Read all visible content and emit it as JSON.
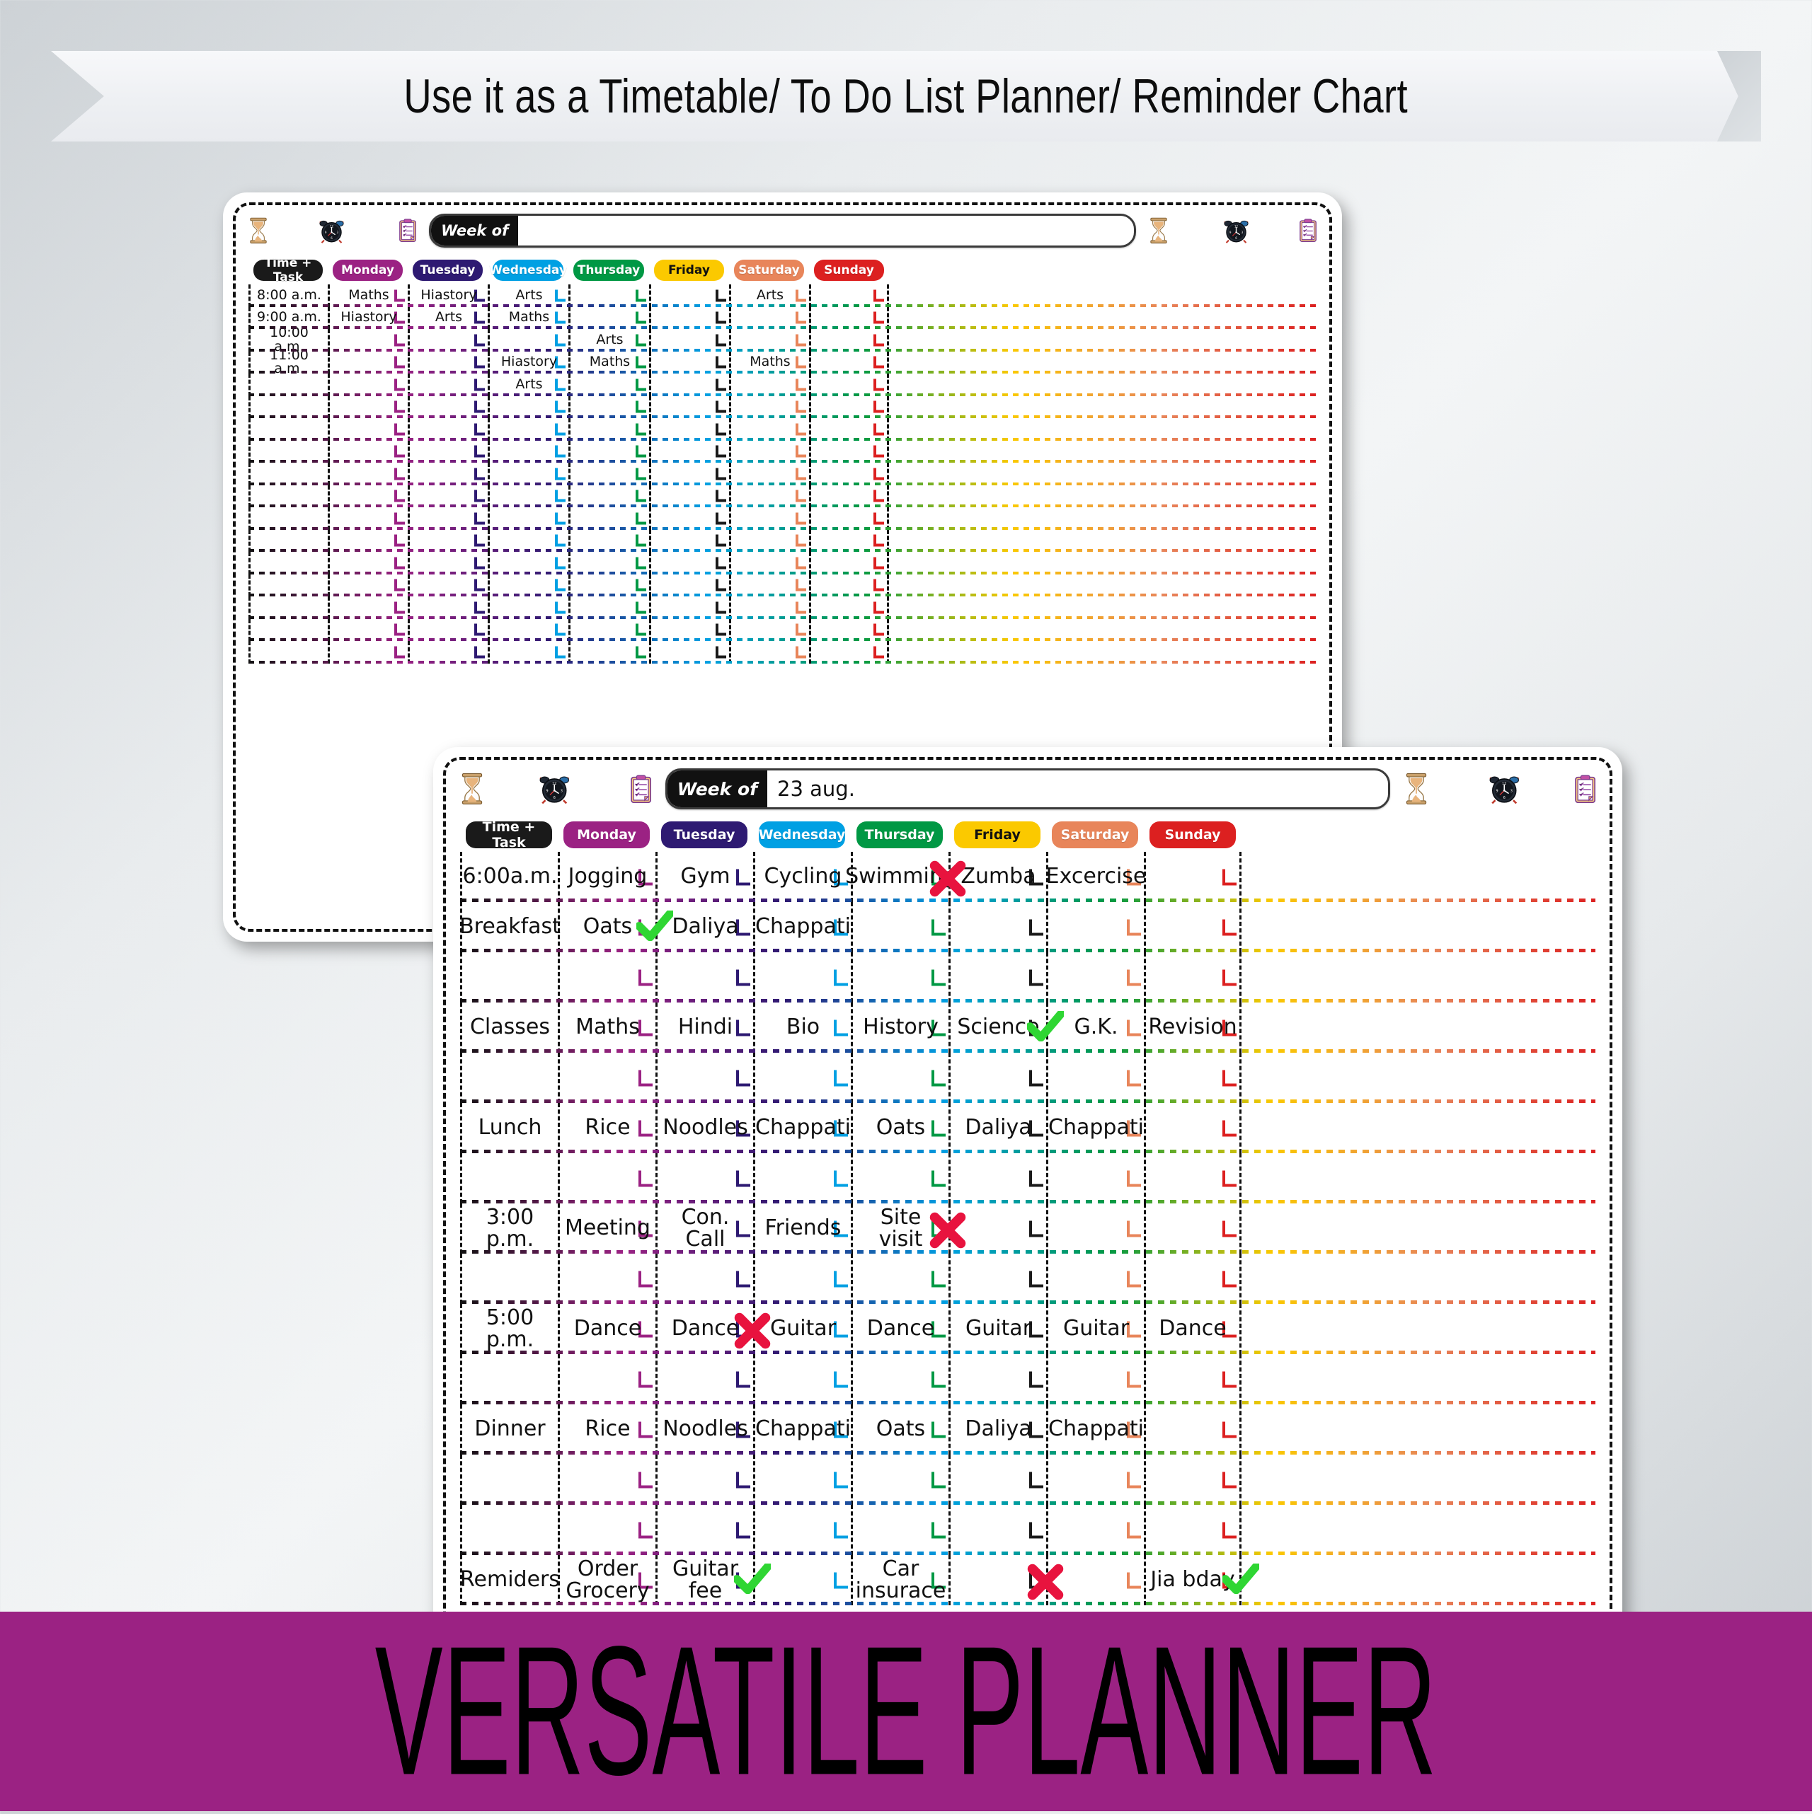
{
  "top_banner": {
    "text": "Use it as a Timetable/ To Do List Planner/ Reminder Chart"
  },
  "bottom_banner": {
    "text": "VERSATILE PLANNER",
    "background": "#9B2283",
    "text_color": "#000000"
  },
  "colors": {
    "time_task": "#1a1a1a",
    "monday": "#9B2283",
    "tuesday": "#2E1A72",
    "wednesday": "#00A0E3",
    "thursday": "#009844",
    "friday": "#FBC900",
    "saturday": "#E8855A",
    "sunday": "#DC2020",
    "friday_bracket": "#1a1a1a",
    "check_green": "#2FD633",
    "cross_red": "#E8133E"
  },
  "header_icons": [
    "hourglass-icon",
    "alarm-clock-icon",
    "clipboard-checklist-icon"
  ],
  "columns": {
    "time_task_label": "Time + Task",
    "days": [
      "Monday",
      "Tuesday",
      "Wednesday",
      "Thursday",
      "Friday",
      "Saturday",
      "Sunday"
    ]
  },
  "week_of": {
    "label": "Week of"
  },
  "planner_back": {
    "week_of_value": "",
    "rows": [
      {
        "time": "8:00 a.m.",
        "cells": [
          "Maths",
          "Hiastory",
          "Arts",
          "",
          "",
          "Arts",
          ""
        ]
      },
      {
        "time": "9:00 a.m.",
        "cells": [
          "Hiastory",
          "Arts",
          "Maths",
          "",
          "",
          "",
          ""
        ]
      },
      {
        "time": "10:00 a.m.",
        "cells": [
          "",
          "",
          "",
          "Arts",
          "",
          "",
          ""
        ]
      },
      {
        "time": "11:00 a.m.",
        "cells": [
          "",
          "",
          "Hiastory",
          "Maths",
          "",
          "Maths",
          ""
        ]
      },
      {
        "time": "",
        "cells": [
          "",
          "",
          "Arts",
          "",
          "",
          "",
          ""
        ]
      },
      {
        "time": "",
        "cells": [
          "",
          "",
          "",
          "",
          "",
          "",
          ""
        ]
      },
      {
        "time": "",
        "cells": [
          "",
          "",
          "",
          "",
          "",
          "",
          ""
        ]
      },
      {
        "time": "",
        "cells": [
          "",
          "",
          "",
          "",
          "",
          "",
          ""
        ]
      },
      {
        "time": "",
        "cells": [
          "",
          "",
          "",
          "",
          "",
          "",
          ""
        ]
      },
      {
        "time": "",
        "cells": [
          "",
          "",
          "",
          "",
          "",
          "",
          ""
        ]
      },
      {
        "time": "",
        "cells": [
          "",
          "",
          "",
          "",
          "",
          "",
          ""
        ]
      },
      {
        "time": "",
        "cells": [
          "",
          "",
          "",
          "",
          "",
          "",
          ""
        ]
      },
      {
        "time": "",
        "cells": [
          "",
          "",
          "",
          "",
          "",
          "",
          ""
        ]
      },
      {
        "time": "",
        "cells": [
          "",
          "",
          "",
          "",
          "",
          "",
          ""
        ]
      },
      {
        "time": "",
        "cells": [
          "",
          "",
          "",
          "",
          "",
          "",
          ""
        ]
      },
      {
        "time": "",
        "cells": [
          "",
          "",
          "",
          "",
          "",
          "",
          ""
        ]
      },
      {
        "time": "",
        "cells": [
          "",
          "",
          "",
          "",
          "",
          "",
          ""
        ]
      }
    ]
  },
  "planner_front": {
    "week_of_value": "23 aug.",
    "rows": [
      {
        "time": "6:00a.m.",
        "cells": [
          "Jogging",
          "Gym",
          "Cycling",
          "Swimming",
          "Zumba",
          "Excercise",
          ""
        ]
      },
      {
        "time": "Breakfast",
        "cells": [
          "Oats",
          "Daliya",
          "Chappati",
          "",
          "",
          "",
          ""
        ]
      },
      {
        "time": "",
        "cells": [
          "",
          "",
          "",
          "",
          "",
          "",
          ""
        ]
      },
      {
        "time": "Classes",
        "cells": [
          "Maths",
          "Hindi",
          "Bio",
          "History",
          "Science",
          "G.K.",
          "Revision"
        ]
      },
      {
        "time": "",
        "cells": [
          "",
          "",
          "",
          "",
          "",
          "",
          ""
        ]
      },
      {
        "time": "Lunch",
        "cells": [
          "Rice",
          "Noodles",
          "Chappati",
          "Oats",
          "Daliya",
          "Chappati",
          ""
        ]
      },
      {
        "time": "",
        "cells": [
          "",
          "",
          "",
          "",
          "",
          "",
          ""
        ]
      },
      {
        "time": "3:00 p.m.",
        "cells": [
          "Meeting",
          "Con. Call",
          "Friends",
          "Site visit",
          "",
          "",
          ""
        ]
      },
      {
        "time": "",
        "cells": [
          "",
          "",
          "",
          "",
          "",
          "",
          ""
        ]
      },
      {
        "time": "5:00 p.m.",
        "cells": [
          "Dance",
          "Dance",
          "Guitar",
          "Dance",
          "Guitar",
          "Guitar",
          "Dance"
        ]
      },
      {
        "time": "",
        "cells": [
          "",
          "",
          "",
          "",
          "",
          "",
          ""
        ]
      },
      {
        "time": "Dinner",
        "cells": [
          "Rice",
          "Noodles",
          "Chappati",
          "Oats",
          "Daliya",
          "Chappati",
          ""
        ]
      },
      {
        "time": "",
        "cells": [
          "",
          "",
          "",
          "",
          "",
          "",
          ""
        ]
      },
      {
        "time": "",
        "cells": [
          "",
          "",
          "",
          "",
          "",
          "",
          ""
        ]
      },
      {
        "time": "Remiders",
        "cells": [
          "Order\nGrocery",
          "Guitar fee",
          "",
          "Car\ninsurace",
          "",
          "",
          "Jia bday"
        ]
      }
    ],
    "marks": [
      {
        "type": "cross-mark",
        "row": 0,
        "col": 4
      },
      {
        "type": "check-mark",
        "row": 1,
        "col": 1
      },
      {
        "type": "check-mark",
        "row": 3,
        "col": 5
      },
      {
        "type": "cross-mark",
        "row": 7,
        "col": 4
      },
      {
        "type": "cross-mark",
        "row": 9,
        "col": 2
      },
      {
        "type": "check-mark",
        "row": 14,
        "col": 2
      },
      {
        "type": "cross-mark",
        "row": 14,
        "col": 5
      },
      {
        "type": "check-mark",
        "row": 14,
        "col": 7
      }
    ]
  }
}
